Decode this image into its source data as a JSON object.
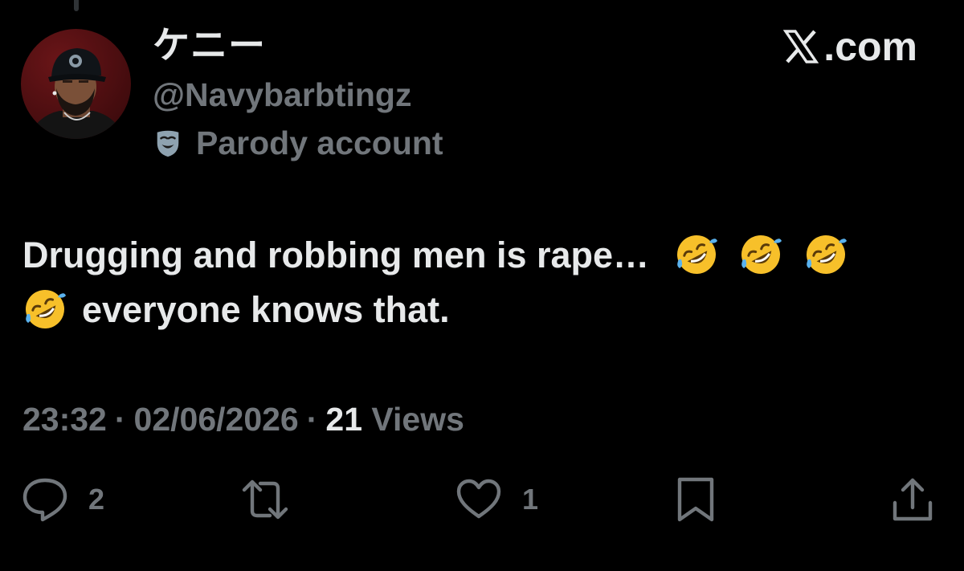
{
  "tweet": {
    "author": {
      "display_name": "ケニー",
      "handle": "@Navybarbtingz",
      "badge_label": "Parody account",
      "badge_icon": "parody-mask-icon",
      "avatar_image": "profile-photo"
    },
    "brand": {
      "text": ".com",
      "icon": "x-logo-icon"
    },
    "text_line1": "Drugging and robbing men is rape…",
    "text_line2": "everyone knows that.",
    "emoji": "rolling-on-floor-laughing-emoji",
    "emoji_count": 4,
    "time": "23:32",
    "date": "02/06/2026",
    "separator": "·",
    "views_count": "21",
    "views_label": "Views",
    "actions": {
      "reply": {
        "icon": "reply-icon",
        "count": "2"
      },
      "retweet": {
        "icon": "retweet-icon",
        "count": ""
      },
      "like": {
        "icon": "like-heart-icon",
        "count": "1"
      },
      "bookmark": {
        "icon": "bookmark-icon"
      },
      "share": {
        "icon": "share-icon"
      }
    }
  },
  "colors": {
    "background": "#000000",
    "primary_text": "#e7e9ea",
    "secondary_text": "#71767b"
  }
}
